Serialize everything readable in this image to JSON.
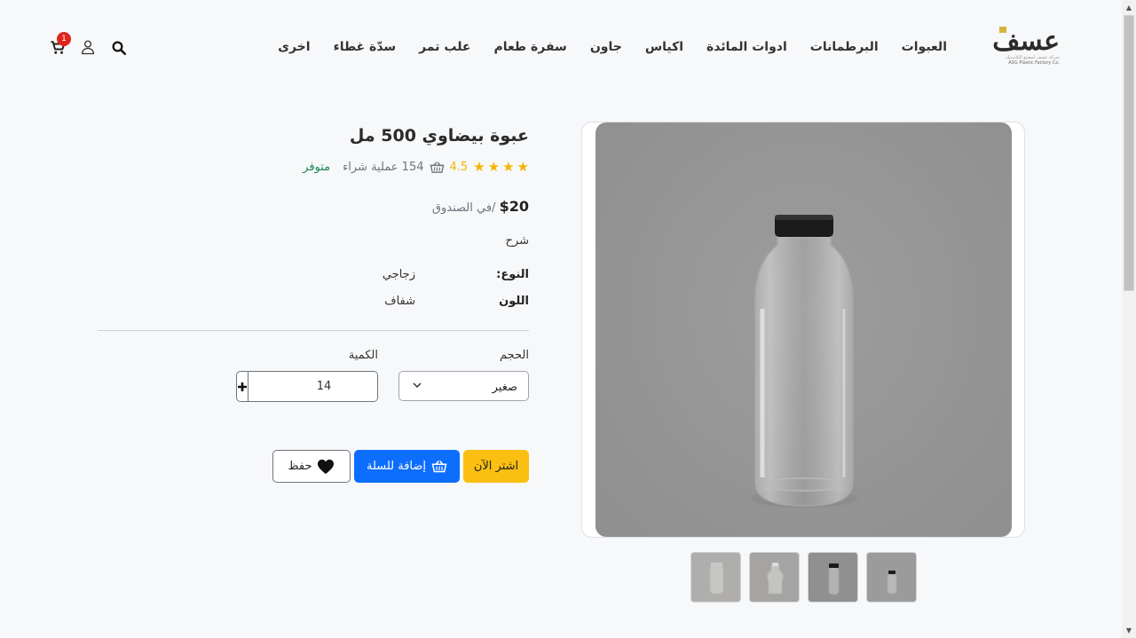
{
  "brand": {
    "logo_text": "عسف",
    "tagline_ar": "شركة عسف لمصنع البلاستيك",
    "tagline_en": "ASG Plastic Factory Co.",
    "accent_color": "#d7b43b"
  },
  "nav": {
    "items": [
      {
        "label": "العبوات"
      },
      {
        "label": "البرطمانات"
      },
      {
        "label": "ادوات المائدة"
      },
      {
        "label": "اكياس"
      },
      {
        "label": "جاون"
      },
      {
        "label": "سفرة طعام"
      },
      {
        "label": "علب تمر"
      },
      {
        "label": "سدّة غطاء"
      },
      {
        "label": "اخرى"
      }
    ]
  },
  "header_icons": {
    "cart_count": "1",
    "icons": [
      "cart-icon",
      "user-icon",
      "search-icon"
    ]
  },
  "product": {
    "title": "عبوة بيضاوي 500 مل",
    "rating": "4.5",
    "stars": 4.5,
    "orders": "154 عملية شراء",
    "stock": "متوفر",
    "price": "$20",
    "price_unit": "/في الصندوق",
    "description_label": "شرح",
    "specs": [
      {
        "key": "النوع:",
        "value": "زجاجي"
      },
      {
        "key": "اللون",
        "value": "شفاف"
      }
    ]
  },
  "options": {
    "size_label": "الحجم",
    "size_value": "صغير",
    "quantity_label": "الكمية",
    "quantity_value": "14"
  },
  "actions": {
    "buy_now": "اشتر الآن",
    "add_to_cart": "إضافة للسلة",
    "save": "حفظ"
  },
  "colors": {
    "star": "#f4b400",
    "stock": "#198754",
    "buy": "#fbbf12",
    "cart": "#0d6efd",
    "badge": "#e0251b"
  }
}
